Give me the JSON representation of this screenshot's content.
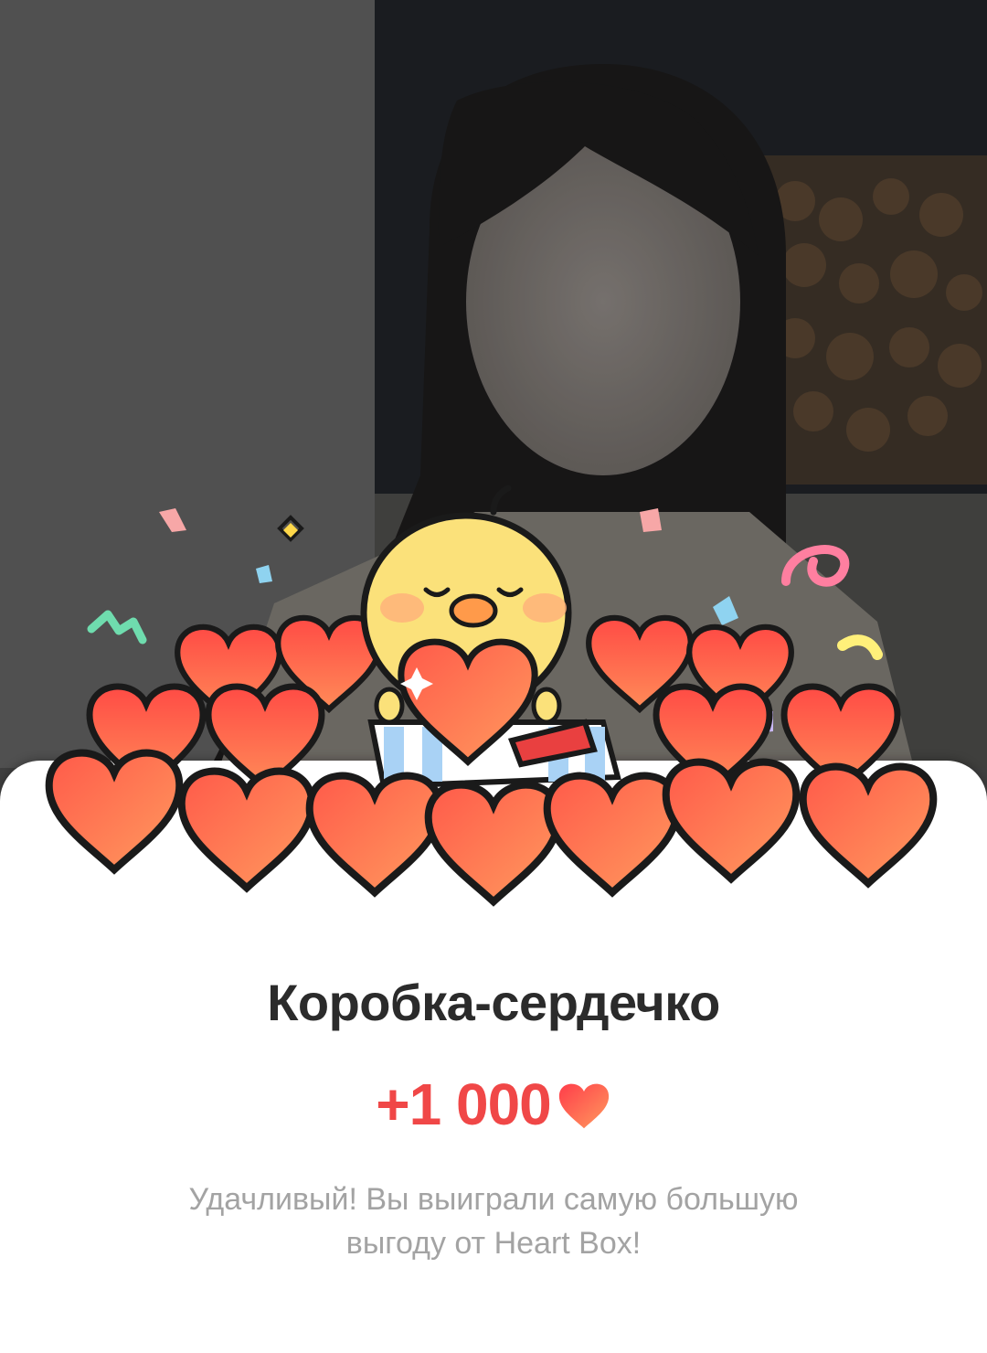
{
  "reward": {
    "title": "Коробка-сердечко",
    "amount": "+1 000",
    "currency_icon": "heart-icon",
    "message": "Удачливый! Вы выиграли самую большую выгоду от Heart Box!"
  },
  "background": {
    "image": "dimmed-portrait-photo"
  },
  "illustration": {
    "name": "chick-holding-heart-in-box-with-hearts"
  },
  "colors": {
    "accent": "#f04747",
    "title_text": "#2b2b2b",
    "message_text": "#a3a3a3",
    "heart_fill_top": "#ff8a5b",
    "heart_fill_bottom": "#f23a3a",
    "chick": "#fbe17a"
  }
}
